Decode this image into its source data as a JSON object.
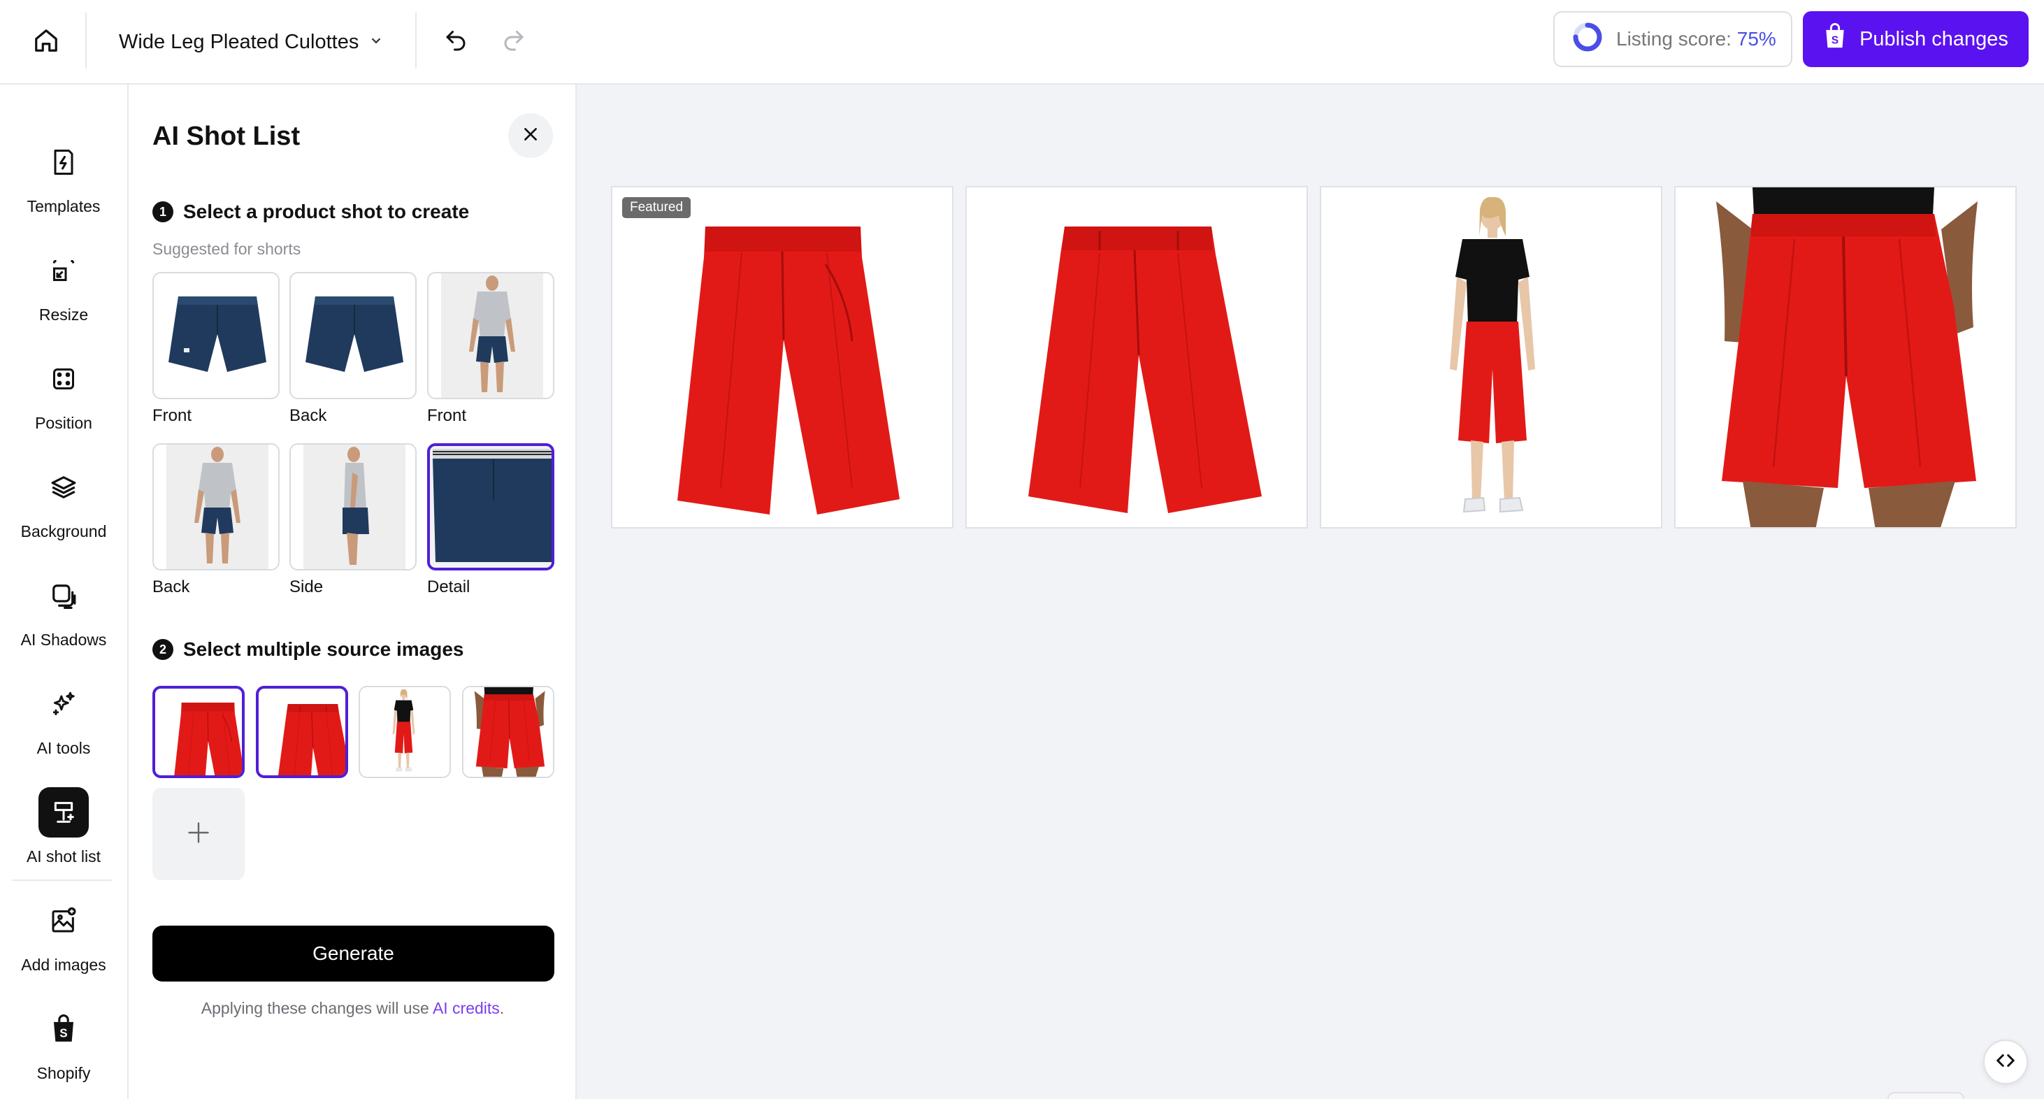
{
  "topbar": {
    "product_title": "Wide Leg Pleated Culottes",
    "listing_score_label": "Listing score:",
    "listing_score_value": "75%",
    "listing_score_fraction": 0.75,
    "publish_label": "Publish changes",
    "colors": {
      "publish_bg": "#5b12f0",
      "score_accent": "#4a4ee6"
    }
  },
  "rail": {
    "items": [
      {
        "label": "Templates",
        "icon": "template-bolt-icon"
      },
      {
        "label": "Resize",
        "icon": "resize-icon"
      },
      {
        "label": "Position",
        "icon": "position-icon"
      },
      {
        "label": "Background",
        "icon": "layers-icon"
      },
      {
        "label": "AI Shadows",
        "icon": "shadow-icon"
      },
      {
        "label": "AI tools",
        "icon": "sparkles-icon"
      },
      {
        "label": "AI shot list",
        "icon": "lamp-icon",
        "active": true
      },
      {
        "label": "Add images",
        "icon": "add-image-icon"
      },
      {
        "label": "Shopify",
        "icon": "shopify-bag-icon"
      }
    ]
  },
  "panel": {
    "title": "AI Shot List",
    "step1": {
      "number": "1",
      "label": "Select a product shot to create",
      "hint": "Suggested for shorts"
    },
    "shots": [
      {
        "label": "Front",
        "kind": "flat-front"
      },
      {
        "label": "Back",
        "kind": "flat-back"
      },
      {
        "label": "Front",
        "kind": "model-front"
      },
      {
        "label": "Back",
        "kind": "model-back"
      },
      {
        "label": "Side",
        "kind": "model-side"
      },
      {
        "label": "Detail",
        "kind": "detail",
        "selected": true
      }
    ],
    "step2": {
      "number": "2",
      "label": "Select multiple source images"
    },
    "sources": [
      {
        "kind": "flat-front",
        "selected": true
      },
      {
        "kind": "flat-back",
        "selected": true
      },
      {
        "kind": "model-full",
        "selected": false
      },
      {
        "kind": "model-crop",
        "selected": false
      }
    ],
    "generate_label": "Generate",
    "credits_prefix": "Applying these changes will use ",
    "credits_link": "AI credits",
    "credits_suffix": "."
  },
  "canvas": {
    "images": [
      {
        "kind": "flat-front",
        "badge": "Featured"
      },
      {
        "kind": "flat-back"
      },
      {
        "kind": "model-full"
      },
      {
        "kind": "model-crop"
      }
    ],
    "colors": {
      "product_red": "#e21a17",
      "sample_navy": "#1f3a5c"
    }
  }
}
